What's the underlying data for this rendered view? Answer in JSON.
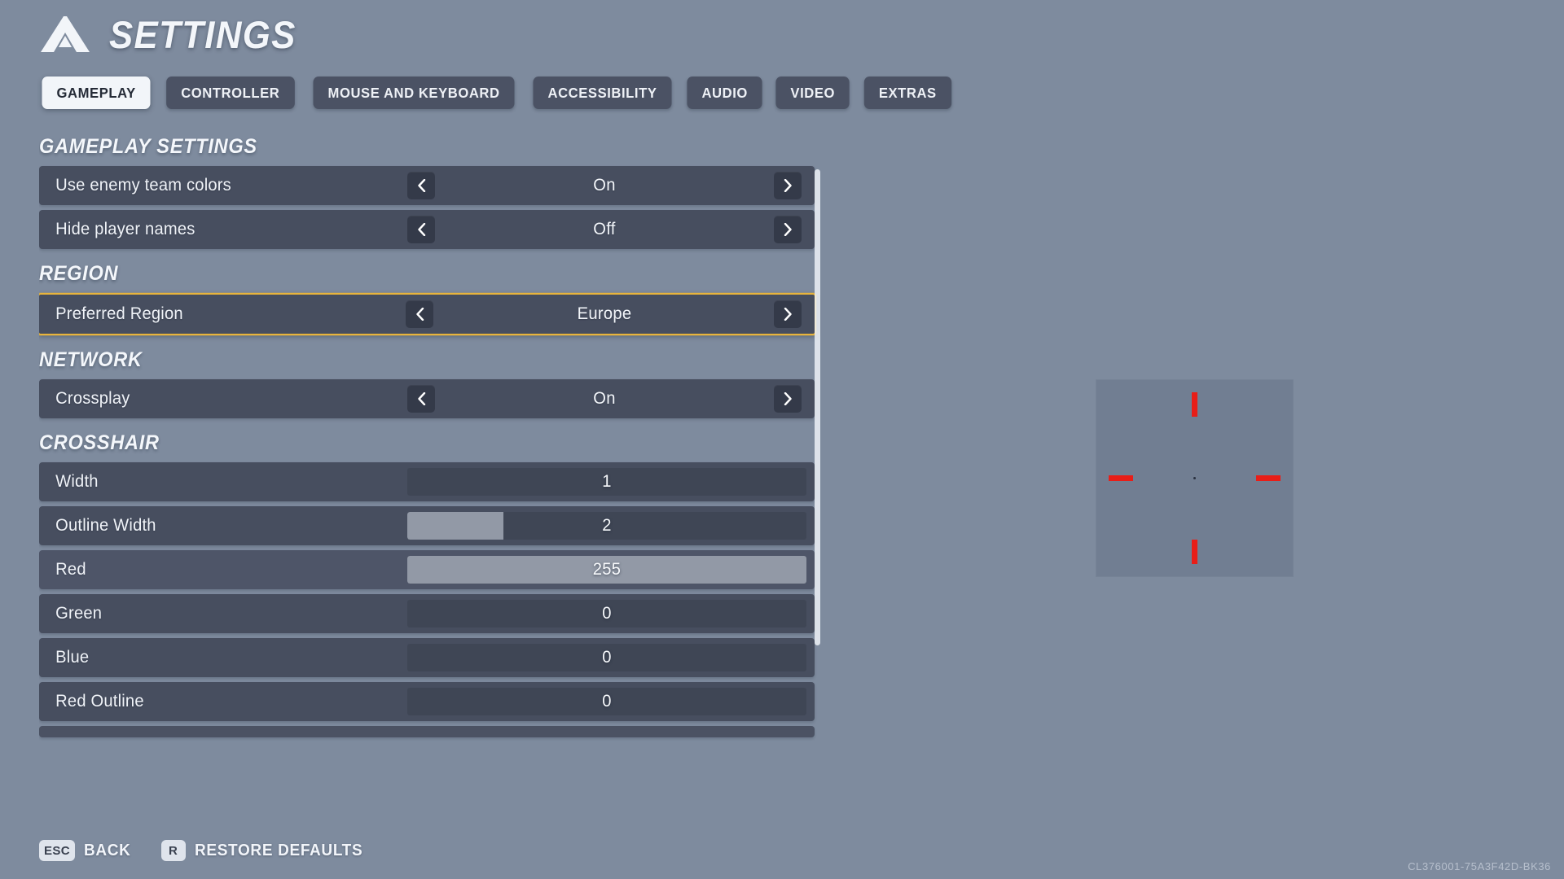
{
  "header": {
    "title": "SETTINGS",
    "logo_icon": "mountain-logo-icon"
  },
  "tabs": [
    {
      "label": "GAMEPLAY",
      "active": true
    },
    {
      "label": "CONTROLLER",
      "active": false
    },
    {
      "label": "MOUSE AND KEYBOARD",
      "active": false
    },
    {
      "label": "ACCESSIBILITY",
      "active": false
    },
    {
      "label": "AUDIO",
      "active": false
    },
    {
      "label": "VIDEO",
      "active": false
    },
    {
      "label": "EXTRAS",
      "active": false
    }
  ],
  "sections": [
    {
      "title": "GAMEPLAY SETTINGS",
      "rows": [
        {
          "type": "selector",
          "label": "Use enemy team colors",
          "value": "On",
          "focused": false
        },
        {
          "type": "selector",
          "label": "Hide player names",
          "value": "Off",
          "focused": false
        }
      ]
    },
    {
      "title": "REGION",
      "rows": [
        {
          "type": "selector",
          "label": "Preferred Region",
          "value": "Europe",
          "focused": true
        }
      ]
    },
    {
      "title": "NETWORK",
      "rows": [
        {
          "type": "selector",
          "label": "Crossplay",
          "value": "On",
          "focused": false
        }
      ]
    },
    {
      "title": "CROSSHAIR",
      "rows": [
        {
          "type": "slider",
          "label": "Width",
          "value": "1",
          "fill_percent": 0,
          "hovered": false
        },
        {
          "type": "slider",
          "label": "Outline Width",
          "value": "2",
          "fill_percent": 24,
          "hovered": false
        },
        {
          "type": "slider",
          "label": "Red",
          "value": "255",
          "fill_percent": 100,
          "hovered": true
        },
        {
          "type": "slider",
          "label": "Green",
          "value": "0",
          "fill_percent": 0,
          "hovered": false
        },
        {
          "type": "slider",
          "label": "Blue",
          "value": "0",
          "fill_percent": 0,
          "hovered": false
        },
        {
          "type": "slider",
          "label": "Red Outline",
          "value": "0",
          "fill_percent": 0,
          "hovered": false
        },
        {
          "type": "partial",
          "label": "",
          "value": "",
          "fill_percent": 0,
          "hovered": false
        }
      ]
    }
  ],
  "selector_icons": {
    "left": "chevron-left-icon",
    "right": "chevron-right-icon"
  },
  "preview": {
    "name": "crosshair-preview",
    "crosshair_color": "#e81e18",
    "background_color": "#717e92",
    "marks": [
      "top",
      "bottom",
      "left",
      "right"
    ],
    "center_dot": true
  },
  "footer": {
    "actions": [
      {
        "key": "ESC",
        "label": "BACK"
      },
      {
        "key": "R",
        "label": "RESTORE DEFAULTS"
      }
    ],
    "build_id": "CL376001-75A3F42D-BK36"
  },
  "colors": {
    "accent_focus": "#e8b43c",
    "row_bg": "#474e5f",
    "tab_active_bg": "#f2f5f9",
    "background": "#7e8b9e"
  }
}
